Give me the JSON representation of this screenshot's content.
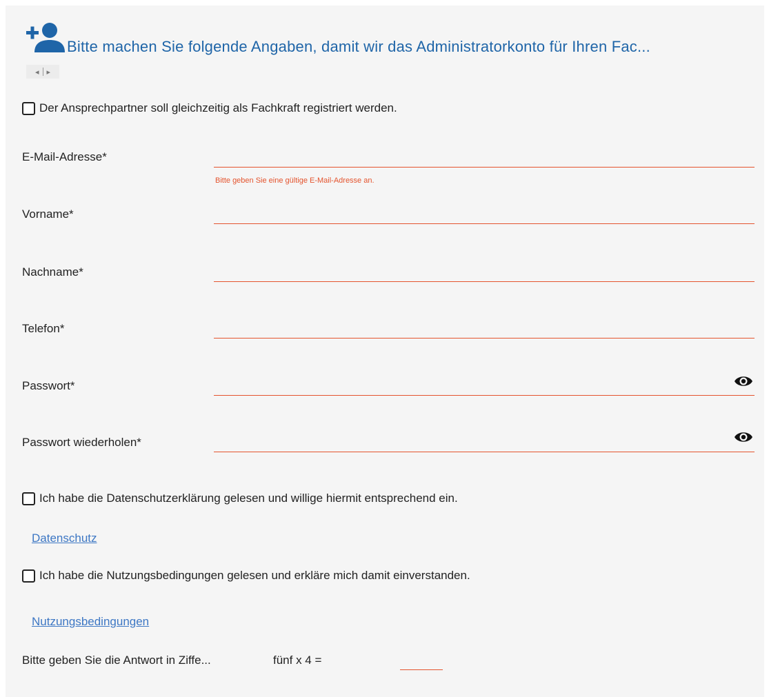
{
  "header": {
    "title": "Bitte machen Sie folgende Angaben, damit wir das Administratorkonto für Ihren Fac...",
    "icon": "add-user-icon",
    "accent_color": "#1f65a8"
  },
  "scroller": {
    "left": "◂",
    "right": "▸"
  },
  "contact_as_specialist": {
    "label": "Der Ansprechpartner soll gleichzeitig als Fachkraft registriert werden.",
    "checked": false
  },
  "fields": {
    "email": {
      "label": "E-Mail-Adresse*",
      "value": "",
      "error": "Bitte geben Sie eine gültige E-Mail-Adresse an."
    },
    "firstname": {
      "label": "Vorname*",
      "value": ""
    },
    "lastname": {
      "label": "Nachname*",
      "value": ""
    },
    "phone": {
      "label": "Telefon*",
      "value": ""
    },
    "password": {
      "label": "Passwort*",
      "value": "",
      "icon": "eye-icon"
    },
    "password_repeat": {
      "label": "Passwort wiederholen*",
      "value": "",
      "icon": "eye-icon"
    }
  },
  "privacy": {
    "label": "Ich habe die Datenschutzerklärung gelesen und willige hiermit entsprechend ein.",
    "checked": false,
    "link": "Datenschutz"
  },
  "terms": {
    "label": "Ich habe die Nutzungsbedingungen gelesen und erkläre mich damit einverstanden.",
    "checked": false,
    "link": "Nutzungsbedingungen"
  },
  "captcha": {
    "label": "Bitte geben Sie die Antwort in Ziffe...",
    "question": "fünf x 4 =",
    "value": ""
  },
  "colors": {
    "error": "#e4532d",
    "link": "#3d77c4",
    "panel_bg": "#f5f5f5"
  }
}
